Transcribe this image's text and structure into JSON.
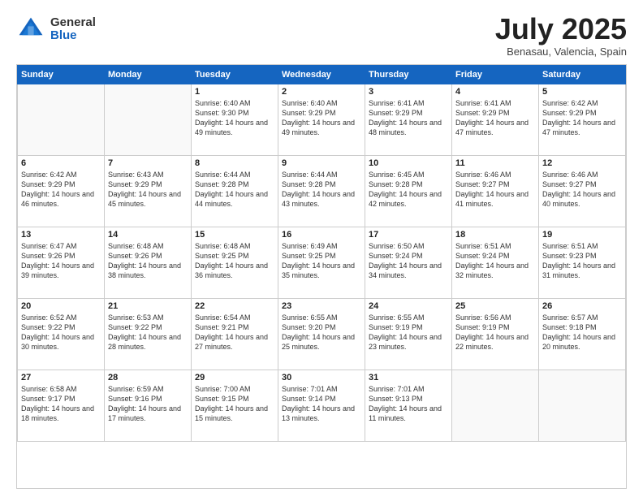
{
  "header": {
    "logo_general": "General",
    "logo_blue": "Blue",
    "month_title": "July 2025",
    "subtitle": "Benasau, Valencia, Spain"
  },
  "weekdays": [
    "Sunday",
    "Monday",
    "Tuesday",
    "Wednesday",
    "Thursday",
    "Friday",
    "Saturday"
  ],
  "weeks": [
    [
      {
        "day": "",
        "info": ""
      },
      {
        "day": "",
        "info": ""
      },
      {
        "day": "1",
        "info": "Sunrise: 6:40 AM\nSunset: 9:30 PM\nDaylight: 14 hours and 49 minutes."
      },
      {
        "day": "2",
        "info": "Sunrise: 6:40 AM\nSunset: 9:29 PM\nDaylight: 14 hours and 49 minutes."
      },
      {
        "day": "3",
        "info": "Sunrise: 6:41 AM\nSunset: 9:29 PM\nDaylight: 14 hours and 48 minutes."
      },
      {
        "day": "4",
        "info": "Sunrise: 6:41 AM\nSunset: 9:29 PM\nDaylight: 14 hours and 47 minutes."
      },
      {
        "day": "5",
        "info": "Sunrise: 6:42 AM\nSunset: 9:29 PM\nDaylight: 14 hours and 47 minutes."
      }
    ],
    [
      {
        "day": "6",
        "info": "Sunrise: 6:42 AM\nSunset: 9:29 PM\nDaylight: 14 hours and 46 minutes."
      },
      {
        "day": "7",
        "info": "Sunrise: 6:43 AM\nSunset: 9:29 PM\nDaylight: 14 hours and 45 minutes."
      },
      {
        "day": "8",
        "info": "Sunrise: 6:44 AM\nSunset: 9:28 PM\nDaylight: 14 hours and 44 minutes."
      },
      {
        "day": "9",
        "info": "Sunrise: 6:44 AM\nSunset: 9:28 PM\nDaylight: 14 hours and 43 minutes."
      },
      {
        "day": "10",
        "info": "Sunrise: 6:45 AM\nSunset: 9:28 PM\nDaylight: 14 hours and 42 minutes."
      },
      {
        "day": "11",
        "info": "Sunrise: 6:46 AM\nSunset: 9:27 PM\nDaylight: 14 hours and 41 minutes."
      },
      {
        "day": "12",
        "info": "Sunrise: 6:46 AM\nSunset: 9:27 PM\nDaylight: 14 hours and 40 minutes."
      }
    ],
    [
      {
        "day": "13",
        "info": "Sunrise: 6:47 AM\nSunset: 9:26 PM\nDaylight: 14 hours and 39 minutes."
      },
      {
        "day": "14",
        "info": "Sunrise: 6:48 AM\nSunset: 9:26 PM\nDaylight: 14 hours and 38 minutes."
      },
      {
        "day": "15",
        "info": "Sunrise: 6:48 AM\nSunset: 9:25 PM\nDaylight: 14 hours and 36 minutes."
      },
      {
        "day": "16",
        "info": "Sunrise: 6:49 AM\nSunset: 9:25 PM\nDaylight: 14 hours and 35 minutes."
      },
      {
        "day": "17",
        "info": "Sunrise: 6:50 AM\nSunset: 9:24 PM\nDaylight: 14 hours and 34 minutes."
      },
      {
        "day": "18",
        "info": "Sunrise: 6:51 AM\nSunset: 9:24 PM\nDaylight: 14 hours and 32 minutes."
      },
      {
        "day": "19",
        "info": "Sunrise: 6:51 AM\nSunset: 9:23 PM\nDaylight: 14 hours and 31 minutes."
      }
    ],
    [
      {
        "day": "20",
        "info": "Sunrise: 6:52 AM\nSunset: 9:22 PM\nDaylight: 14 hours and 30 minutes."
      },
      {
        "day": "21",
        "info": "Sunrise: 6:53 AM\nSunset: 9:22 PM\nDaylight: 14 hours and 28 minutes."
      },
      {
        "day": "22",
        "info": "Sunrise: 6:54 AM\nSunset: 9:21 PM\nDaylight: 14 hours and 27 minutes."
      },
      {
        "day": "23",
        "info": "Sunrise: 6:55 AM\nSunset: 9:20 PM\nDaylight: 14 hours and 25 minutes."
      },
      {
        "day": "24",
        "info": "Sunrise: 6:55 AM\nSunset: 9:19 PM\nDaylight: 14 hours and 23 minutes."
      },
      {
        "day": "25",
        "info": "Sunrise: 6:56 AM\nSunset: 9:19 PM\nDaylight: 14 hours and 22 minutes."
      },
      {
        "day": "26",
        "info": "Sunrise: 6:57 AM\nSunset: 9:18 PM\nDaylight: 14 hours and 20 minutes."
      }
    ],
    [
      {
        "day": "27",
        "info": "Sunrise: 6:58 AM\nSunset: 9:17 PM\nDaylight: 14 hours and 18 minutes."
      },
      {
        "day": "28",
        "info": "Sunrise: 6:59 AM\nSunset: 9:16 PM\nDaylight: 14 hours and 17 minutes."
      },
      {
        "day": "29",
        "info": "Sunrise: 7:00 AM\nSunset: 9:15 PM\nDaylight: 14 hours and 15 minutes."
      },
      {
        "day": "30",
        "info": "Sunrise: 7:01 AM\nSunset: 9:14 PM\nDaylight: 14 hours and 13 minutes."
      },
      {
        "day": "31",
        "info": "Sunrise: 7:01 AM\nSunset: 9:13 PM\nDaylight: 14 hours and 11 minutes."
      },
      {
        "day": "",
        "info": ""
      },
      {
        "day": "",
        "info": ""
      }
    ]
  ]
}
